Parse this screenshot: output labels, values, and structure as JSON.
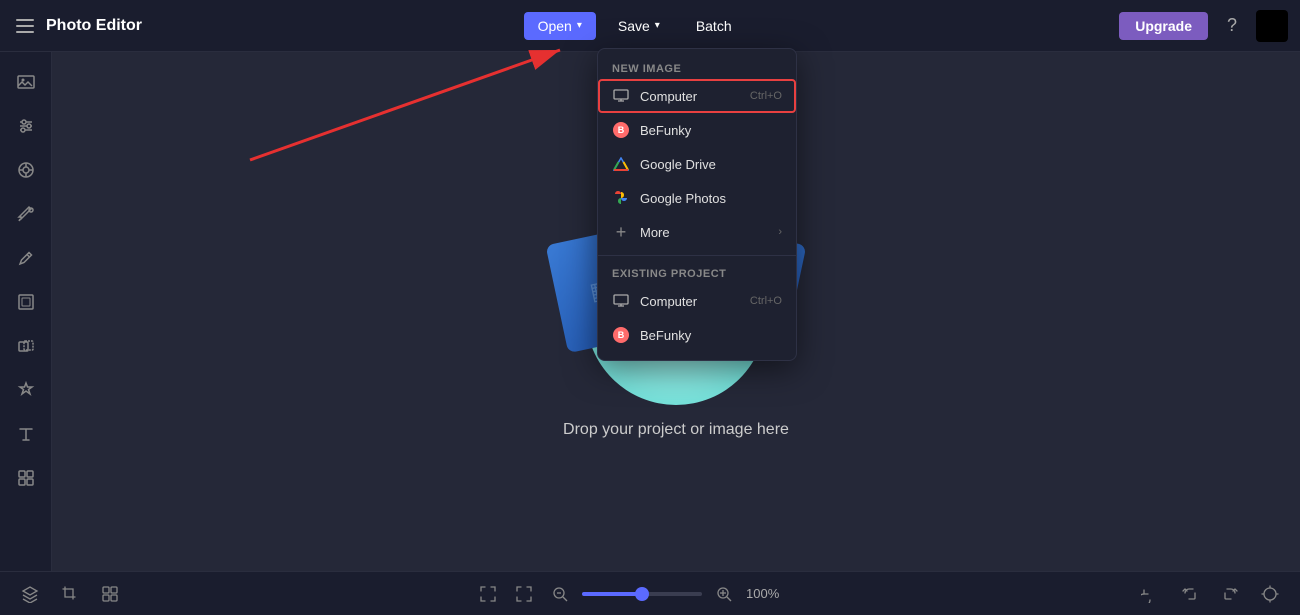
{
  "header": {
    "menu_icon": "☰",
    "title": "Photo Editor",
    "open_label": "Open",
    "open_chevron": "▾",
    "save_label": "Save",
    "save_chevron": "▾",
    "batch_label": "Batch",
    "upgrade_label": "Upgrade",
    "help_icon": "?"
  },
  "sidebar": {
    "items": [
      {
        "icon": "🖼",
        "label": "image"
      },
      {
        "icon": "⚙",
        "label": "adjustments"
      },
      {
        "icon": "👁",
        "label": "effects"
      },
      {
        "icon": "✨",
        "label": "touch-up"
      },
      {
        "icon": "✏",
        "label": "draw"
      },
      {
        "icon": "▭",
        "label": "frames"
      },
      {
        "icon": "❖",
        "label": "overlays"
      },
      {
        "icon": "🏷",
        "label": "stickers"
      },
      {
        "icon": "T",
        "label": "text"
      },
      {
        "icon": "⊞",
        "label": "graphics"
      }
    ]
  },
  "dropdown": {
    "new_image_header": "New Image",
    "computer_label": "Computer",
    "computer_shortcut": "Ctrl+O",
    "befunky_label": "BeFunky",
    "gdrive_label": "Google Drive",
    "gphotos_label": "Google Photos",
    "more_label": "More",
    "existing_header": "Existing Project",
    "existing_computer_label": "Computer",
    "existing_computer_shortcut": "Ctrl+O",
    "existing_befunky_label": "BeFunky"
  },
  "canvas": {
    "drop_text": "Drop your project or image here"
  },
  "bottombar": {
    "zoom_value": 50,
    "zoom_display": "100%"
  }
}
